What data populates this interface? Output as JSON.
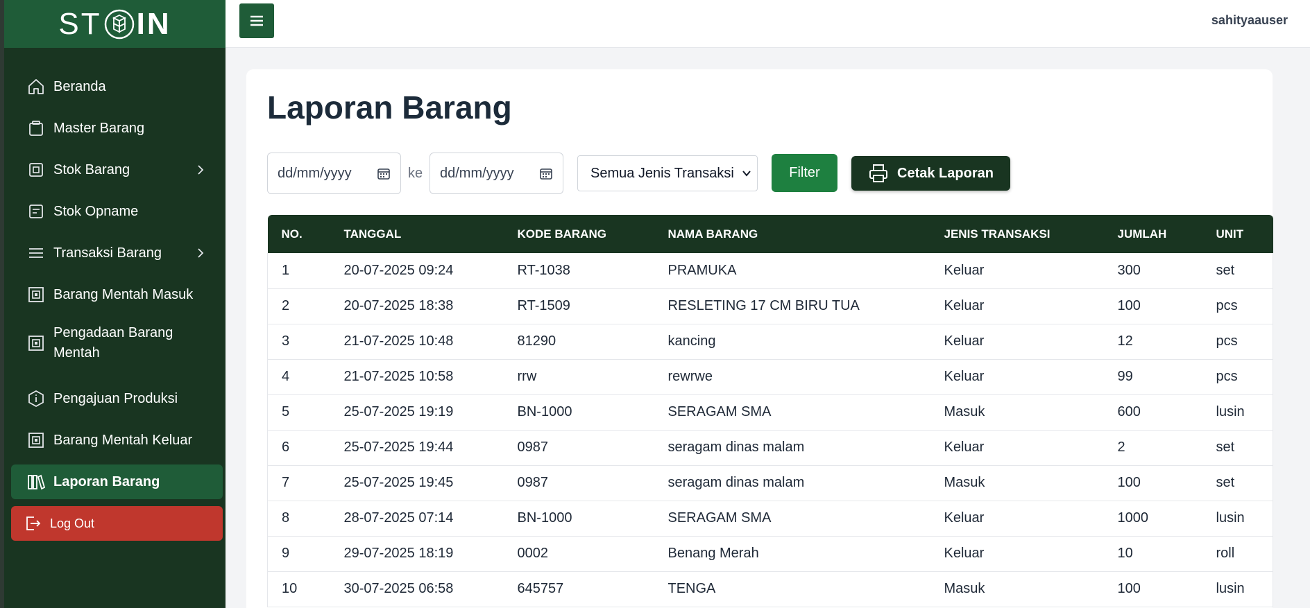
{
  "app": {
    "brand_left": "ST",
    "brand_right": "IN",
    "username": "sahityaauser"
  },
  "sidebar": {
    "items": [
      {
        "label": "Beranda",
        "icon": "home-icon"
      },
      {
        "label": "Master Barang",
        "icon": "clipboard-icon"
      },
      {
        "label": "Stok Barang",
        "icon": "square-icon",
        "chevron": true
      },
      {
        "label": "Stok Opname",
        "icon": "document-icon"
      },
      {
        "label": "Transaksi Barang",
        "icon": "list-icon",
        "chevron": true
      },
      {
        "label": "Barang Mentah Masuk",
        "icon": "box-icon"
      },
      {
        "label": "Pengadaan Barang Mentah",
        "icon": "box-icon"
      },
      {
        "label": "Pengajuan Produksi",
        "icon": "hexagon-icon"
      },
      {
        "label": "Barang Mentah Keluar",
        "icon": "box-icon"
      },
      {
        "label": "Laporan Barang",
        "icon": "books-icon",
        "active": true
      }
    ],
    "logout_label": "Log Out"
  },
  "main": {
    "title": "Laporan Barang",
    "filters": {
      "date_from_placeholder": "dd/mm/yyyy",
      "separator": "ke",
      "date_to_placeholder": "dd/mm/yyyy",
      "type_selected": "Semua Jenis Transaksi",
      "filter_label": "Filter",
      "print_label": "Cetak Laporan"
    },
    "table": {
      "columns": [
        "NO.",
        "TANGGAL",
        "KODE BARANG",
        "NAMA BARANG",
        "JENIS TRANSAKSI",
        "JUMLAH",
        "UNIT"
      ],
      "rows": [
        [
          "1",
          "20-07-2025 09:24",
          "RT-1038",
          "PRAMUKA",
          "Keluar",
          "300",
          "set"
        ],
        [
          "2",
          "20-07-2025 18:38",
          "RT-1509",
          "RESLETING 17 CM BIRU TUA",
          "Keluar",
          "100",
          "pcs"
        ],
        [
          "3",
          "21-07-2025 10:48",
          "81290",
          "kancing",
          "Keluar",
          "12",
          "pcs"
        ],
        [
          "4",
          "21-07-2025 10:58",
          "rrw",
          "rewrwe",
          "Keluar",
          "99",
          "pcs"
        ],
        [
          "5",
          "25-07-2025 19:19",
          "BN-1000",
          "SERAGAM SMA",
          "Masuk",
          "600",
          "lusin"
        ],
        [
          "6",
          "25-07-2025 19:44",
          "0987",
          "seragam dinas malam",
          "Keluar",
          "2",
          "set"
        ],
        [
          "7",
          "25-07-2025 19:45",
          "0987",
          "seragam dinas malam",
          "Masuk",
          "100",
          "set"
        ],
        [
          "8",
          "28-07-2025 07:14",
          "BN-1000",
          "SERAGAM SMA",
          "Keluar",
          "1000",
          "lusin"
        ],
        [
          "9",
          "29-07-2025 18:19",
          "0002",
          "Benang Merah",
          "Keluar",
          "10",
          "roll"
        ],
        [
          "10",
          "30-07-2025 06:58",
          "645757",
          "TENGA",
          "Masuk",
          "100",
          "lusin"
        ]
      ]
    }
  }
}
